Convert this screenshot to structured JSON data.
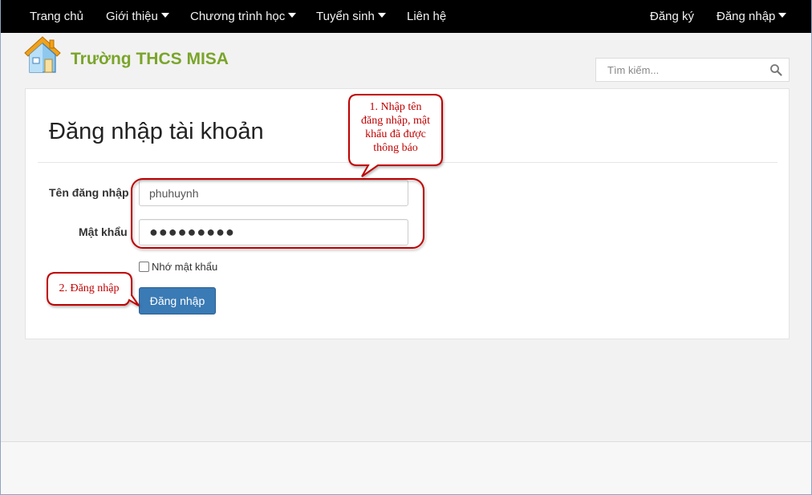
{
  "nav": {
    "left": [
      {
        "label": "Trang chủ",
        "dropdown": false
      },
      {
        "label": "Giới thiệu",
        "dropdown": true
      },
      {
        "label": "Chương trình học",
        "dropdown": true
      },
      {
        "label": "Tuyển sinh",
        "dropdown": true
      },
      {
        "label": "Liên hệ",
        "dropdown": false
      }
    ],
    "right": [
      {
        "label": "Đăng ký",
        "dropdown": false
      },
      {
        "label": "Đăng nhập",
        "dropdown": true
      }
    ]
  },
  "header": {
    "site_title": "Trường THCS MISA",
    "logo_icon": "house-icon",
    "search_placeholder": "Tìm kiếm..."
  },
  "login": {
    "title": "Đăng nhập tài khoản",
    "username_label": "Tên đăng nhập",
    "username_value": "phuhuynh",
    "password_label": "Mật khẩu",
    "password_value": "●●●●●●●●●",
    "remember_label": "Nhớ mật khẩu",
    "remember_checked": false,
    "submit_label": "Đăng nhập"
  },
  "annotations": {
    "callout_1": [
      "1. Nhập tên",
      "đăng nhập, mật",
      "khẩu đã được",
      "thông báo"
    ],
    "callout_2": "2. Đăng nhập"
  },
  "colors": {
    "navbar": "#000000",
    "brand_green": "#7aa52a",
    "button_blue": "#3a7ab5",
    "annotation_red": "#c00000"
  }
}
